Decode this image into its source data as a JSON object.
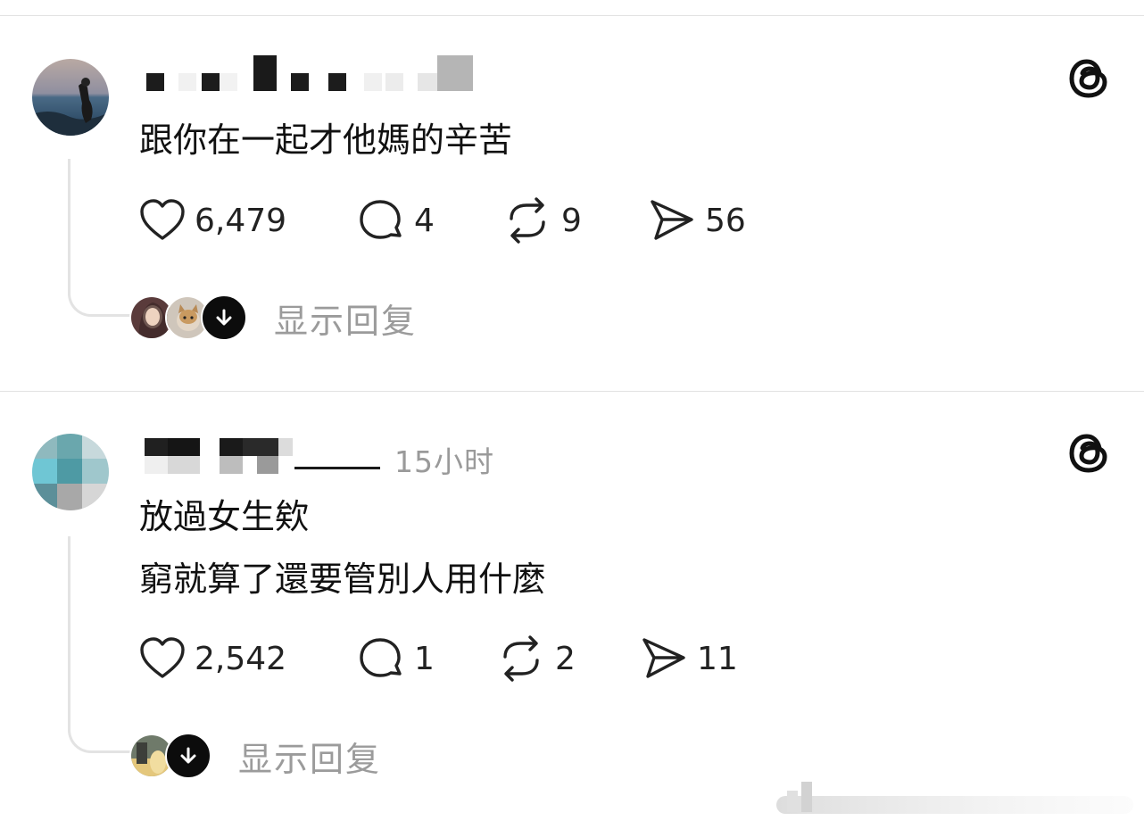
{
  "posts": [
    {
      "username": "",
      "timestamp": "",
      "text_lines": [
        "跟你在一起才他媽的辛苦"
      ],
      "actions": {
        "like_count": "6,479",
        "reply_count": "4",
        "repost_count": "9",
        "share_count": "56"
      },
      "show_replies_label": "显示回复",
      "reply_avatars": [
        "reply-avatar-1",
        "reply-avatar-2"
      ]
    },
    {
      "username": "",
      "timestamp": "15小时",
      "text_lines": [
        "放過女生欸",
        "窮就算了還要管別人用什麼"
      ],
      "actions": {
        "like_count": "2,542",
        "reply_count": "1",
        "repost_count": "2",
        "share_count": "11"
      },
      "show_replies_label": "显示回复",
      "reply_avatars": [
        "reply-avatar-1"
      ]
    }
  ],
  "icons": {
    "like": "heart-icon",
    "reply": "comment-icon",
    "repost": "repost-icon",
    "share": "send-icon",
    "brand": "threads-logo-icon",
    "expand": "arrow-down-icon"
  },
  "colors": {
    "text": "#111111",
    "muted": "#9b9b9b",
    "divider": "#e2e2e2",
    "thread_line": "#e3e3e3",
    "badge": "#0c0c0c"
  }
}
